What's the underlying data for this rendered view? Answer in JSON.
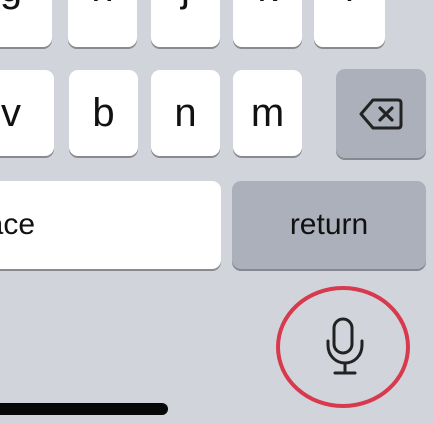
{
  "keyboard": {
    "top_row": [
      {
        "label": "g"
      },
      {
        "label": "h"
      },
      {
        "label": "j"
      },
      {
        "label": "k"
      },
      {
        "label": "l"
      }
    ],
    "letter_row": [
      {
        "label": "v"
      },
      {
        "label": "b"
      },
      {
        "label": "n"
      },
      {
        "label": "m"
      }
    ],
    "space_label": "pace",
    "return_label": "return",
    "delete_icon": "delete-left-icon",
    "mic_icon": "microphone-icon"
  },
  "colors": {
    "background": "#d2d4db",
    "key": "#ffffff",
    "dark_key": "#abb0ba",
    "annotation_circle": "#d7394d",
    "icon": "#222222"
  }
}
